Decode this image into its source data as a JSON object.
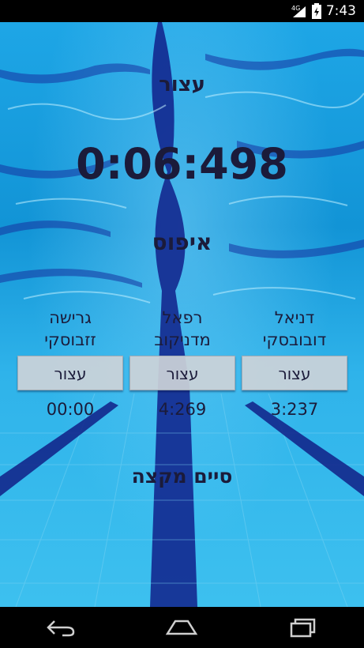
{
  "status_bar": {
    "network": "4G",
    "time": "7:43"
  },
  "stopwatch": {
    "status": "עצור",
    "elapsed": "0:06:498",
    "reset_label": "איפוס",
    "finish_label": "סיים מקצה"
  },
  "lanes": [
    {
      "first_name": "גרישה",
      "last_name": "זזבוסקי",
      "button": "עצור",
      "time": "00:00"
    },
    {
      "first_name": "רפאל",
      "last_name": "מדניקוב",
      "button": "עצור",
      "time": "4:269"
    },
    {
      "first_name": "דניאל",
      "last_name": "דובובסקי",
      "button": "עצור",
      "time": "3:237"
    }
  ],
  "nav": {
    "back": "back-icon",
    "home": "home-icon",
    "recents": "recents-icon"
  },
  "colors": {
    "water": "#1ea6e6",
    "text": "#1b1b3a",
    "button": "#cdd2d8"
  }
}
